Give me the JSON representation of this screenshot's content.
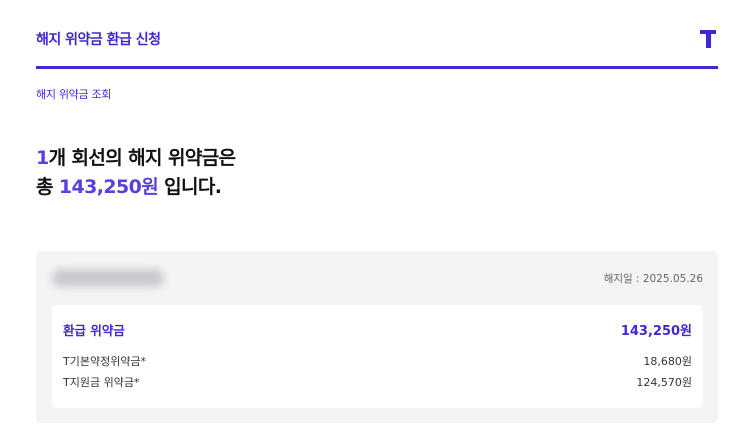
{
  "header": {
    "title": "해지 위약금 환급 신청",
    "logo": "T"
  },
  "subnav": {
    "label": "해지 위약금 조회"
  },
  "headline": {
    "count": "1",
    "line1_rest": "개 회선의 해지 위약금은",
    "line2_prefix": "총 ",
    "amount": "143,250원",
    "line2_suffix": " 입니다."
  },
  "card": {
    "cancel_date": "해지일 : 2025.05.26",
    "refund": {
      "label": "환급 위약금",
      "value": "143,250원"
    },
    "items": [
      {
        "label": "T기본약정위약금*",
        "value": "18,680원"
      },
      {
        "label": "T지원금 위약금*",
        "value": "124,570원"
      }
    ]
  },
  "colors": {
    "accent": "#3d2ad0",
    "card_bg": "#f3f4f6"
  }
}
